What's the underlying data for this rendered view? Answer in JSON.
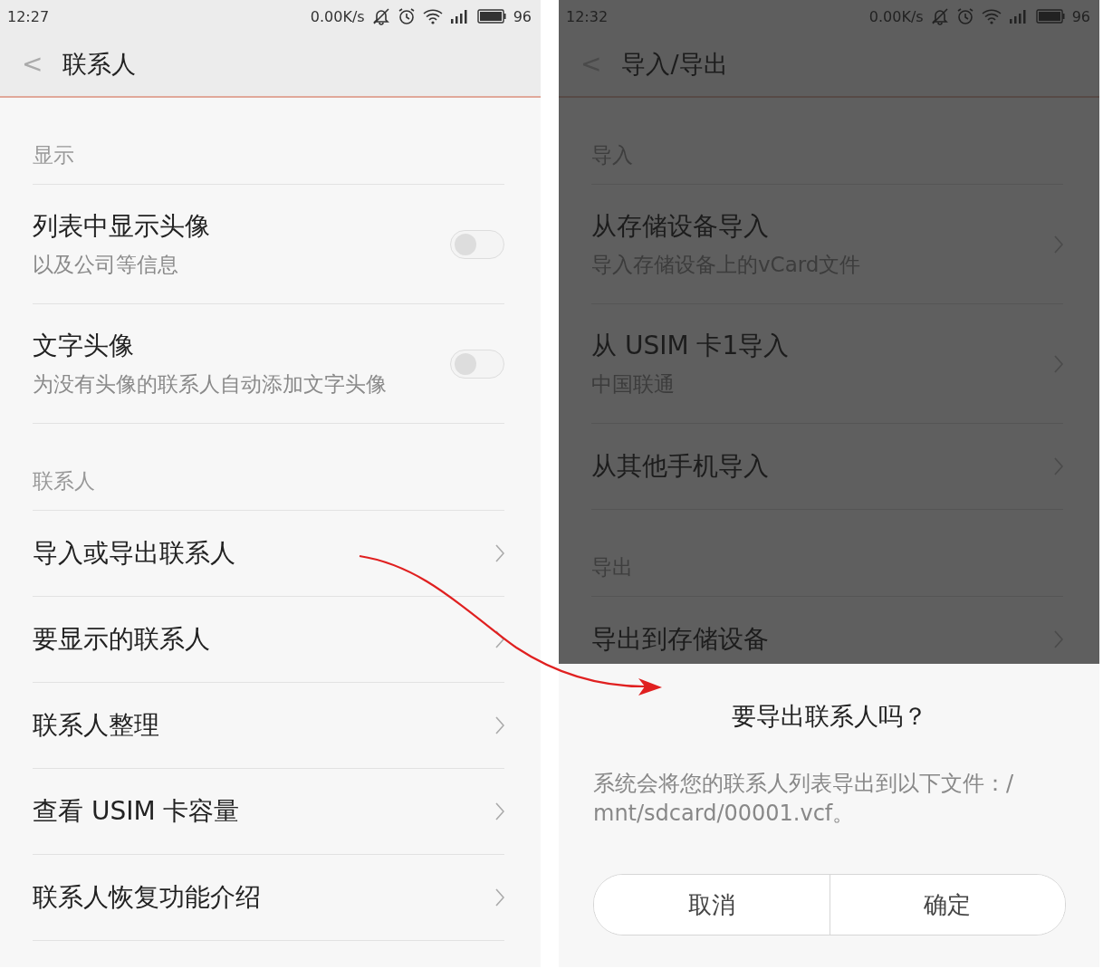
{
  "screens": [
    {
      "dimmed": false,
      "status_bar": {
        "time": "12:27",
        "speed": "0.00K/s",
        "battery": "96"
      },
      "header": {
        "back": "<",
        "title": "联系人"
      },
      "sections": [
        {
          "title": "显示",
          "items": [
            {
              "kind": "switch",
              "title": "列表中显示头像",
              "subtitle": "以及公司等信息",
              "on": false
            },
            {
              "kind": "switch",
              "title": "文字头像",
              "subtitle": "为没有头像的联系人自动添加文字头像",
              "on": false
            }
          ]
        },
        {
          "title": "联系人",
          "items": [
            {
              "kind": "link",
              "title": "导入或导出联系人"
            },
            {
              "kind": "link",
              "title": "要显示的联系人"
            },
            {
              "kind": "link",
              "title": "联系人整理"
            },
            {
              "kind": "link",
              "title": "查看 USIM 卡容量"
            },
            {
              "kind": "link",
              "title": "联系人恢复功能介绍"
            }
          ]
        }
      ]
    },
    {
      "dimmed": true,
      "status_bar": {
        "time": "12:32",
        "speed": "0.00K/s",
        "battery": "96"
      },
      "header": {
        "back": "<",
        "title": "导入/导出"
      },
      "sections": [
        {
          "title": "导入",
          "items": [
            {
              "kind": "link",
              "title": "从存储设备导入",
              "subtitle": "导入存储设备上的vCard文件"
            },
            {
              "kind": "link",
              "title": "从 USIM 卡1导入",
              "subtitle": "中国联通"
            },
            {
              "kind": "link",
              "title": "从其他手机导入"
            }
          ]
        },
        {
          "title": "导出",
          "items": [
            {
              "kind": "link",
              "title": "导出到存储设备"
            }
          ]
        }
      ],
      "dialog": {
        "title": "要导出联系人吗？",
        "message": "系统会将您的联系人列表导出到以下文件：/\nmnt/sdcard/00001.vcf。",
        "buttons": [
          "取消",
          "确定"
        ]
      }
    }
  ]
}
